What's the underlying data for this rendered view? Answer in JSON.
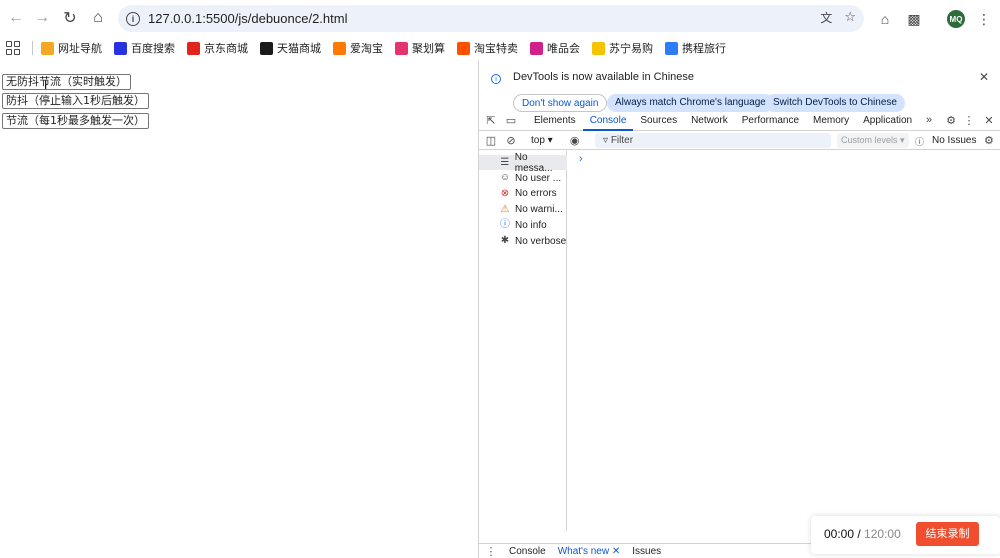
{
  "browser": {
    "url": "127.0.0.1:5500/js/debuonce/2.html",
    "profile_initials": "MQ"
  },
  "bookmarks": [
    {
      "label": "网址导航",
      "icon": "star-icon",
      "color": "#f5a623"
    },
    {
      "label": "百度搜索",
      "icon": "paw-icon",
      "color": "#2932e1"
    },
    {
      "label": "京东商城",
      "icon": "jd-icon",
      "color": "#e1251b"
    },
    {
      "label": "天猫商城",
      "icon": "tmall-icon",
      "color": "#1a1a1a"
    },
    {
      "label": "爱淘宝",
      "icon": "taobao-icon",
      "color": "#ff7a00"
    },
    {
      "label": "聚划算",
      "icon": "juhuasuan-icon",
      "color": "#e5336e"
    },
    {
      "label": "淘宝特卖",
      "icon": "taobao-sale-icon",
      "color": "#ff5000"
    },
    {
      "label": "唯品会",
      "icon": "vip-icon",
      "color": "#d0208a"
    },
    {
      "label": "苏宁易购",
      "icon": "suning-icon",
      "color": "#f5c400"
    },
    {
      "label": "携程旅行",
      "icon": "ctrip-icon",
      "color": "#2e7cf6"
    }
  ],
  "page": {
    "buttons": [
      "无防抖节流（实时触发）",
      "防抖（停止输入1秒后触发）",
      "节流（每1秒最多触发一次）"
    ]
  },
  "devtools": {
    "infobar": {
      "message": "DevTools is now available in Chinese",
      "dont_show": "Don't show again",
      "match_language": "Always match Chrome's language",
      "switch_language": "Switch DevTools to Chinese"
    },
    "tabs": [
      "Elements",
      "Console",
      "Sources",
      "Network",
      "Performance",
      "Memory",
      "Application"
    ],
    "active_tab": "Console",
    "context": "top",
    "filter_placeholder": "Filter",
    "levels": "Custom levels",
    "issues": "No Issues",
    "sidebar": [
      {
        "label": "No messa...",
        "icon": "list-icon"
      },
      {
        "label": "No user ...",
        "icon": "user-icon"
      },
      {
        "label": "No errors",
        "icon": "error-icon"
      },
      {
        "label": "No warni...",
        "icon": "warning-icon"
      },
      {
        "label": "No info",
        "icon": "info-icon"
      },
      {
        "label": "No verbose",
        "icon": "bug-icon"
      }
    ],
    "drawer_tabs": [
      "Console",
      "What's new",
      "Issues"
    ]
  },
  "recorder": {
    "elapsed": "00:00",
    "total": "120:00",
    "stop_label": "结束录制",
    "stop_color": "#f04e2e"
  }
}
